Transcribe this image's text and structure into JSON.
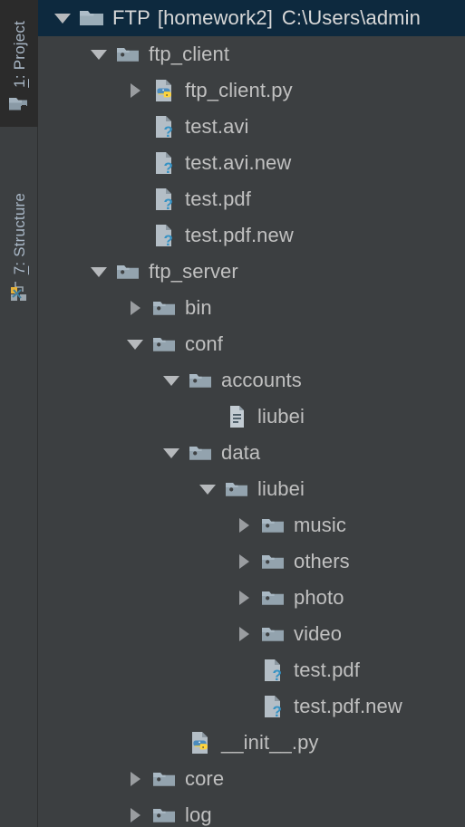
{
  "window": {
    "background_color": "#3c3f41",
    "selection_color": "#0d293e",
    "text_color": "#c0c0c0",
    "dim_text_color": "#7d8287"
  },
  "sidebar": {
    "tabs": [
      {
        "mnemonic": "1",
        "separator": ": ",
        "label": "Project",
        "full_label": "1: Project",
        "icon": "project-folder-icon",
        "active": true
      },
      {
        "mnemonic": "7",
        "separator": ": ",
        "label": "Structure",
        "full_label": "7: Structure",
        "icon": "structure-nodes-icon",
        "active": false
      }
    ]
  },
  "tree": {
    "rows": [
      {
        "name": "FTP",
        "bracket": "[homework2]",
        "path": "C:\\Users\\admin",
        "icon": "folder-icon",
        "arrow": "expanded",
        "depth": 0,
        "selected": true
      },
      {
        "name": "ftp_client",
        "icon": "module-folder-icon",
        "arrow": "expanded",
        "depth": 1,
        "selected": false
      },
      {
        "name": "ftp_client.py",
        "icon": "python-file-icon",
        "arrow": "collapsed",
        "depth": 2,
        "selected": false
      },
      {
        "name": "test.avi",
        "icon": "unknown-file-icon",
        "arrow": "none",
        "depth": 2,
        "selected": false
      },
      {
        "name": "test.avi.new",
        "icon": "unknown-file-icon",
        "arrow": "none",
        "depth": 2,
        "selected": false
      },
      {
        "name": "test.pdf",
        "icon": "unknown-file-icon",
        "arrow": "none",
        "depth": 2,
        "selected": false
      },
      {
        "name": "test.pdf.new",
        "icon": "unknown-file-icon",
        "arrow": "none",
        "depth": 2,
        "selected": false
      },
      {
        "name": "ftp_server",
        "icon": "module-folder-icon",
        "arrow": "expanded",
        "depth": 1,
        "selected": false
      },
      {
        "name": "bin",
        "icon": "module-folder-icon",
        "arrow": "collapsed",
        "depth": 2,
        "selected": false
      },
      {
        "name": "conf",
        "icon": "module-folder-icon",
        "arrow": "expanded",
        "depth": 2,
        "selected": false
      },
      {
        "name": "accounts",
        "icon": "module-folder-icon",
        "arrow": "expanded",
        "depth": 3,
        "selected": false
      },
      {
        "name": "liubei",
        "icon": "text-file-icon",
        "arrow": "none",
        "depth": 4,
        "selected": false
      },
      {
        "name": "data",
        "icon": "module-folder-icon",
        "arrow": "expanded",
        "depth": 3,
        "selected": false
      },
      {
        "name": "liubei",
        "icon": "module-folder-icon",
        "arrow": "expanded",
        "depth": 4,
        "selected": false
      },
      {
        "name": "music",
        "icon": "module-folder-icon",
        "arrow": "collapsed",
        "depth": 5,
        "selected": false
      },
      {
        "name": "others",
        "icon": "module-folder-icon",
        "arrow": "collapsed",
        "depth": 5,
        "selected": false
      },
      {
        "name": "photo",
        "icon": "module-folder-icon",
        "arrow": "collapsed",
        "depth": 5,
        "selected": false
      },
      {
        "name": "video",
        "icon": "module-folder-icon",
        "arrow": "collapsed",
        "depth": 5,
        "selected": false
      },
      {
        "name": "test.pdf",
        "icon": "unknown-file-icon",
        "arrow": "none",
        "depth": 5,
        "selected": false
      },
      {
        "name": "test.pdf.new",
        "icon": "unknown-file-icon",
        "arrow": "none",
        "depth": 5,
        "selected": false
      },
      {
        "name": "__init__.py",
        "icon": "python-file-icon",
        "arrow": "none",
        "depth": 3,
        "selected": false
      },
      {
        "name": "core",
        "icon": "module-folder-icon",
        "arrow": "collapsed",
        "depth": 2,
        "selected": false
      },
      {
        "name": "log",
        "icon": "module-folder-icon",
        "arrow": "collapsed",
        "depth": 2,
        "selected": false
      }
    ]
  }
}
